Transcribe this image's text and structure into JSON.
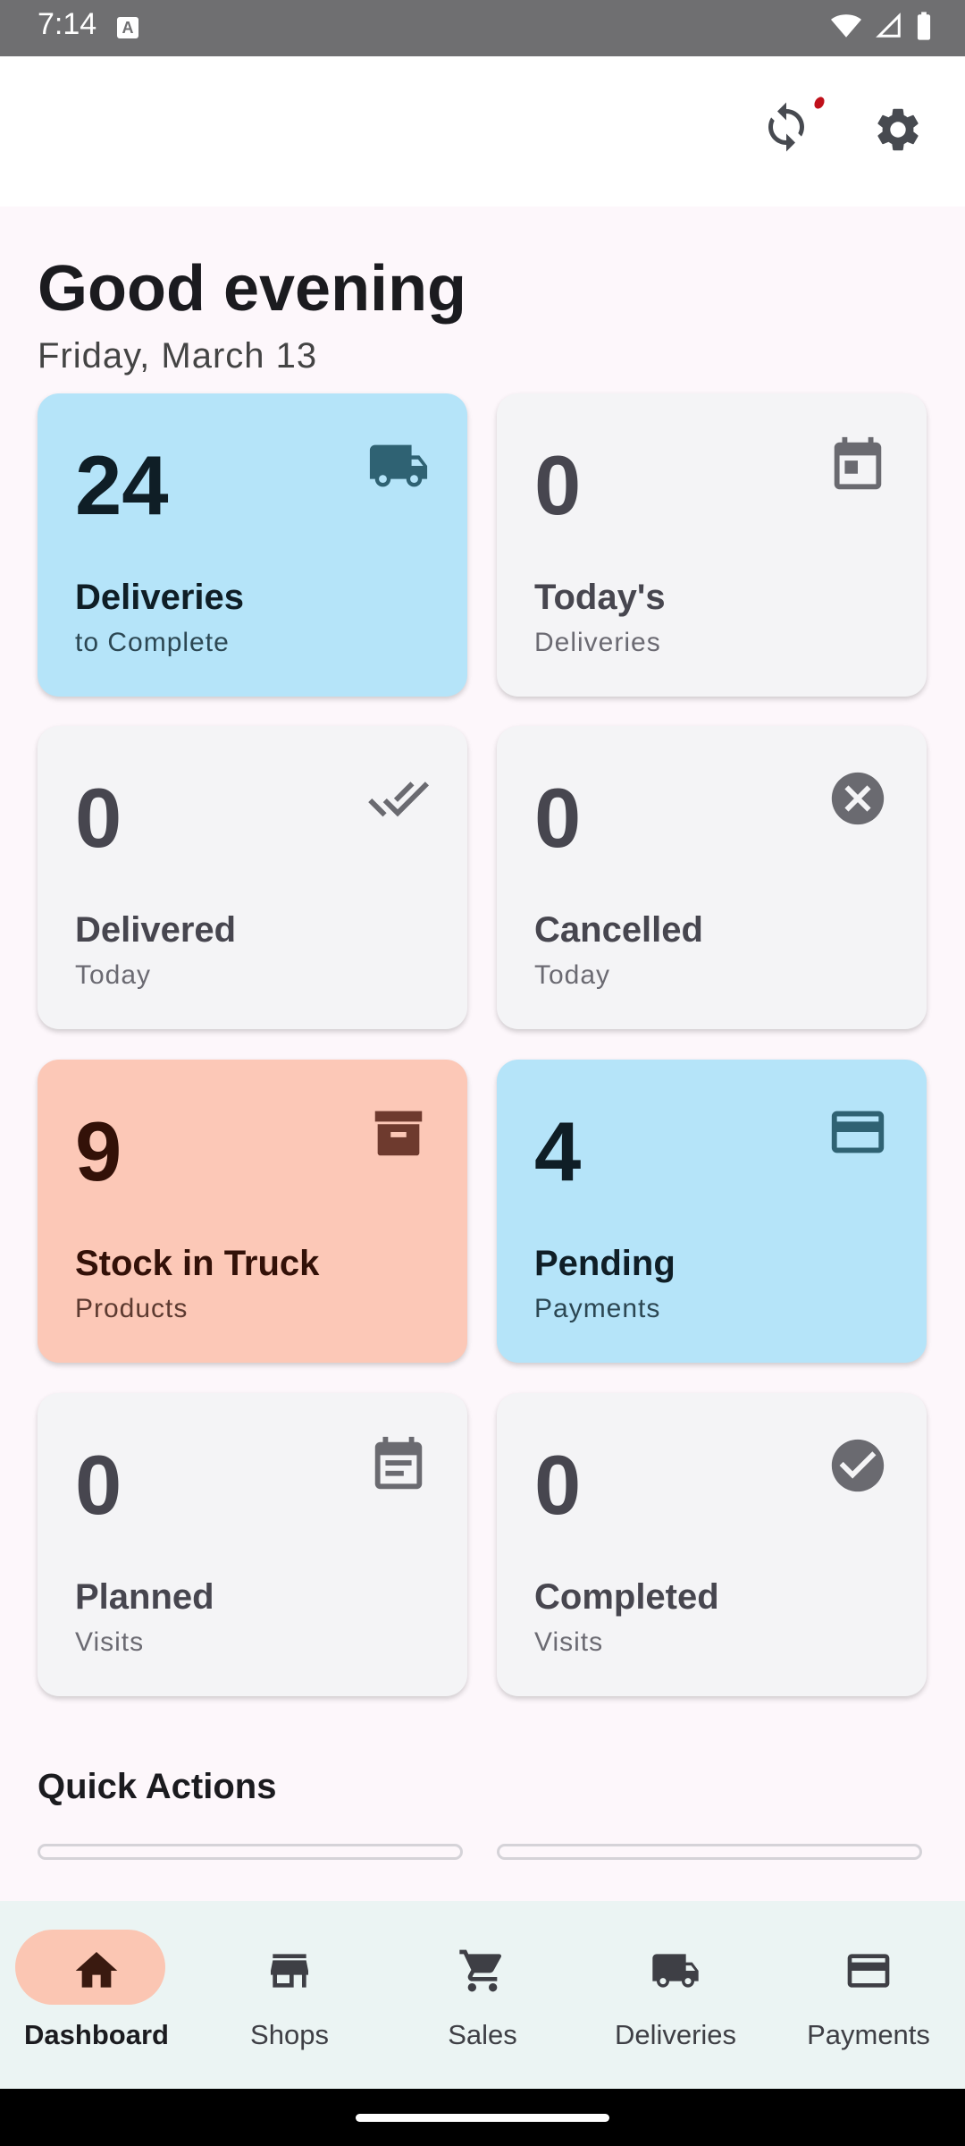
{
  "status": {
    "time": "7:14",
    "indicator": "A"
  },
  "header": {
    "sync_icon": "sync-icon",
    "settings_icon": "gear-icon",
    "accent": "#c0101a"
  },
  "greeting": {
    "title": "Good evening",
    "date": "Friday, March 13"
  },
  "stats": [
    {
      "value": "24",
      "title": "Deliveries",
      "subtitle": "to Complete",
      "icon": "truck-icon",
      "style": "blue"
    },
    {
      "value": "0",
      "title": "Today's",
      "subtitle": "Deliveries",
      "icon": "calendar-icon",
      "style": "grey"
    },
    {
      "value": "0",
      "title": "Delivered",
      "subtitle": "Today",
      "icon": "double-check-icon",
      "style": "grey"
    },
    {
      "value": "0",
      "title": "Cancelled",
      "subtitle": "Today",
      "icon": "cancel-icon",
      "style": "grey"
    },
    {
      "value": "9",
      "title": "Stock in Truck",
      "subtitle": "Products",
      "icon": "archive-icon",
      "style": "salmon"
    },
    {
      "value": "4",
      "title": "Pending",
      "subtitle": "Payments",
      "icon": "credit-card-icon",
      "style": "blue"
    },
    {
      "value": "0",
      "title": "Planned",
      "subtitle": "Visits",
      "icon": "event-note-icon",
      "style": "grey"
    },
    {
      "value": "0",
      "title": "Completed",
      "subtitle": "Visits",
      "icon": "check-circle-icon",
      "style": "grey"
    }
  ],
  "quick_actions": {
    "title": "Quick Actions"
  },
  "nav": [
    {
      "label": "Dashboard",
      "icon": "home-icon",
      "active": true
    },
    {
      "label": "Shops",
      "icon": "store-icon",
      "active": false
    },
    {
      "label": "Sales",
      "icon": "cart-icon",
      "active": false
    },
    {
      "label": "Deliveries",
      "icon": "truck-icon",
      "active": false
    },
    {
      "label": "Payments",
      "icon": "credit-card-icon",
      "active": false
    }
  ],
  "colors": {
    "card_blue": "#b5e4f9",
    "card_salmon": "#fcc8b7",
    "card_grey": "#f4f4f6",
    "nav_active_pill": "#fbc6b3",
    "nav_bg": "#ebf4f3"
  }
}
